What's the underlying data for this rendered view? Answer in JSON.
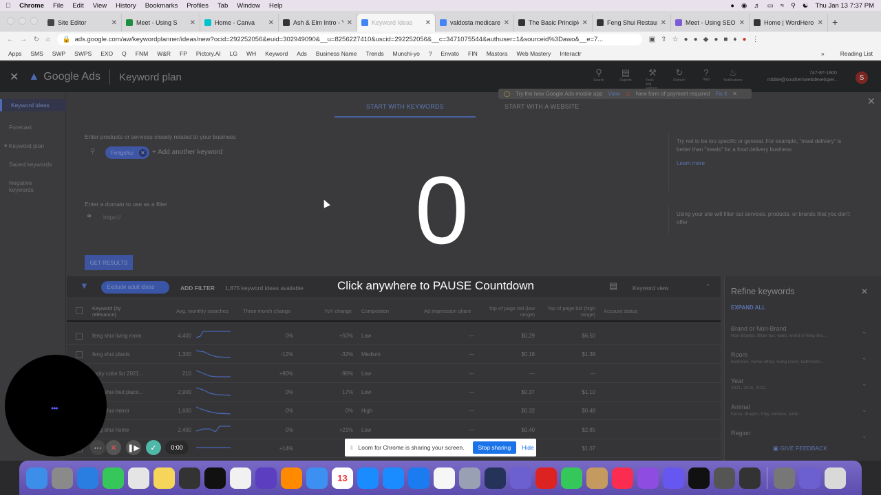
{
  "macmenu": {
    "app": "Chrome",
    "items": [
      "File",
      "Edit",
      "View",
      "History",
      "Bookmarks",
      "Profiles",
      "Tab",
      "Window",
      "Help"
    ],
    "clock": "Thu Jan 13  7:37 PM"
  },
  "tabs": [
    {
      "title": "Site Editor",
      "color": "#444"
    },
    {
      "title": "Meet - Using S",
      "color": "#1e8e3e"
    },
    {
      "title": "Home - Canva",
      "color": "#00c4cc"
    },
    {
      "title": "Ash & Elm Intro - Y",
      "color": "#333"
    },
    {
      "title": "Keyword Ideas",
      "color": "#4285f4",
      "active": true
    },
    {
      "title": "valdosta medicare",
      "color": "#4285f4"
    },
    {
      "title": "The Basic Principle",
      "color": "#333"
    },
    {
      "title": "Feng Shui Restaur",
      "color": "#333"
    },
    {
      "title": "Meet - Using SEO",
      "color": "#7b5cd6"
    },
    {
      "title": "Home | WordHero",
      "color": "#333"
    }
  ],
  "url": "ads.google.com/aw/keywordplanner/ideas/new?ocid=292252056&euid=302949090&__u=8256227410&uscid=292252056&__c=3471075544&authuser=1&sourceid%3Dawo&__e=7...",
  "bookmarks": [
    "Apps",
    "SMS",
    "SWP",
    "SWPS",
    "EXO",
    "Q",
    "FNM",
    "W&R",
    "FP",
    "Pictory.AI",
    "LG",
    "WH",
    "Keyword",
    "Ads",
    "Business Name",
    "Trends",
    "Munchi-yo",
    "?",
    "Envato",
    "FIN",
    "Mastora",
    "Web Mastery",
    "Interactr"
  ],
  "bookmarks_more": "Reading List",
  "ads": {
    "logo": "Google Ads",
    "page": "Keyword plan",
    "header_icons": [
      "Search",
      "Reports",
      "Tools and settings",
      "Refresh",
      "Help",
      "Notifications"
    ],
    "account_id": "747-87-1800",
    "account_email": "robbie@southernwebdeveloper...",
    "avatar": "S",
    "sidebar": [
      "Keyword ideas",
      "Forecast",
      "Keyword plan",
      "Saved keywords",
      "Negative keywords"
    ],
    "tab_keywords": "START WITH KEYWORDS",
    "tab_website": "START WITH A WEBSITE",
    "banner_app": "Try the new Google Ads mobile app",
    "banner_view": "View",
    "banner_payment": "New form of payment required",
    "banner_fix": "Fix it",
    "enter_products_label": "Enter products or services closely related to your business",
    "chip": "Fengshui",
    "add_keyword": "+ Add another keyword",
    "tip": "Try not to be too specific or general. For example, \"meal delivery\" is better than \"meals\" for a food delivery business",
    "learn_more": "Learn more",
    "domain_label": "Enter a domain to use as a filter",
    "domain_placeholder": "https://",
    "domain_tip": "Using your site will filter out services, products, or brands that you don't offer",
    "get_results": "GET RESULTS",
    "exclude_adult": "Exclude adult ideas",
    "add_filter": "ADD FILTER",
    "ideas_count": "1,875 keyword ideas available",
    "columns_label": "Columns",
    "keyword_view": "Keyword view"
  },
  "table": {
    "headers": [
      "Keyword (by relevance)",
      "Avg. monthly searches",
      "Three month change",
      "YoY change",
      "Competition",
      "Ad impression share",
      "Top of page bid (low range)",
      "Top of page bid (high range)",
      "Account status"
    ],
    "rows": [
      {
        "kw": "feng shui living room",
        "avg": "4,400",
        "three": "0%",
        "yoy": "+50%",
        "comp": "Low",
        "imp": "—",
        "low": "$0.29",
        "high": "$6.50"
      },
      {
        "kw": "feng shui plants",
        "avg": "1,300",
        "three": "-12%",
        "yoy": "-32%",
        "comp": "Medium",
        "imp": "—",
        "low": "$0.18",
        "high": "$1.38"
      },
      {
        "kw": "lucky color for 2021...",
        "avg": "210",
        "three": "+80%",
        "yoy": "-96%",
        "comp": "Low",
        "imp": "—",
        "low": "—",
        "high": "—"
      },
      {
        "kw": "feng shui bed place...",
        "avg": "2,900",
        "three": "0%",
        "yoy": "17%",
        "comp": "Low",
        "imp": "—",
        "low": "$0.37",
        "high": "$1.10"
      },
      {
        "kw": "feng shui mirror",
        "avg": "1,600",
        "three": "0%",
        "yoy": "0%",
        "comp": "High",
        "imp": "—",
        "low": "$0.32",
        "high": "$0.48"
      },
      {
        "kw": "feng shui home",
        "avg": "2,400",
        "three": "0%",
        "yoy": "+21%",
        "comp": "Low",
        "imp": "—",
        "low": "$0.40",
        "high": "$2.85"
      },
      {
        "kw": "",
        "avg": "",
        "three": "+14%",
        "yoy": "",
        "comp": "",
        "imp": "",
        "low": "",
        "high": "$1.07"
      }
    ]
  },
  "refine": {
    "title": "Refine keywords",
    "expand_all": "EXPAND ALL",
    "groups": [
      {
        "name": "Brand or Non-Brand",
        "sub": "Non-Brands, lillian too, wars, world of feng shu..."
      },
      {
        "name": "Room",
        "sub": "bedroom, home office, living room, bathroom..."
      },
      {
        "name": "Year",
        "sub": "2021, 2020, 2022"
      },
      {
        "name": "Animal",
        "sub": "horse, dragon, frog, tortoise, turtle"
      },
      {
        "name": "Region",
        "sub": ""
      }
    ],
    "feedback": "GIVE FEEDBACK"
  },
  "loom": {
    "countdown": "0",
    "pause_text": "Click anywhere to PAUSE Countdown",
    "timer": "0:00",
    "share_msg": "Loom for Chrome is sharing your screen.",
    "stop_sharing": "Stop sharing",
    "hide": "Hide"
  },
  "dock": [
    {
      "name": "Finder",
      "color": "#3d8ee8"
    },
    {
      "name": "System Preferences",
      "color": "#8a8a8a"
    },
    {
      "name": "Settings",
      "color": "#2a7de1"
    },
    {
      "name": "Messages",
      "color": "#35c759"
    },
    {
      "name": "Chrome",
      "color": "#e5e5e5"
    },
    {
      "name": "Notes",
      "color": "#f5d65b"
    },
    {
      "name": "Grid",
      "color": "#333"
    },
    {
      "name": "TikTok",
      "color": "#111"
    },
    {
      "name": "Reminders",
      "color": "#f1f1f1"
    },
    {
      "name": "iMovie Star",
      "color": "#5b3fc0"
    },
    {
      "name": "GarageBand",
      "color": "#ff8a00"
    },
    {
      "name": "Mail",
      "color": "#3c90f2"
    },
    {
      "name": "Calendar",
      "color": "#ffffff",
      "label": "13"
    },
    {
      "name": "Safari",
      "color": "#1a8cff"
    },
    {
      "name": "App Store",
      "color": "#1a8cff"
    },
    {
      "name": "Shield",
      "color": "#1a7cf0"
    },
    {
      "name": "Photos",
      "color": "#f6f6f6"
    },
    {
      "name": "Launchpad",
      "color": "#9aa0b4"
    },
    {
      "name": "QuickTime",
      "color": "#25335a"
    },
    {
      "name": "Help",
      "color": "#6c5fd0"
    },
    {
      "name": "Photo Booth",
      "color": "#d22"
    },
    {
      "name": "FaceTime",
      "color": "#35c759"
    },
    {
      "name": "Contacts",
      "color": "#c59a5e"
    },
    {
      "name": "Music",
      "color": "#fa2c4f"
    },
    {
      "name": "Podcasts",
      "color": "#8e4de0"
    },
    {
      "name": "Loom",
      "color": "#6657f0"
    },
    {
      "name": "K",
      "color": "#111"
    },
    {
      "name": "Screenshot",
      "color": "#555"
    },
    {
      "name": "Calculator",
      "color": "#333"
    },
    {
      "name": "Archive",
      "color": "#777"
    },
    {
      "name": "Help2",
      "color": "#6c5fd0"
    },
    {
      "name": "Trash",
      "color": "#d9d9d9"
    }
  ]
}
